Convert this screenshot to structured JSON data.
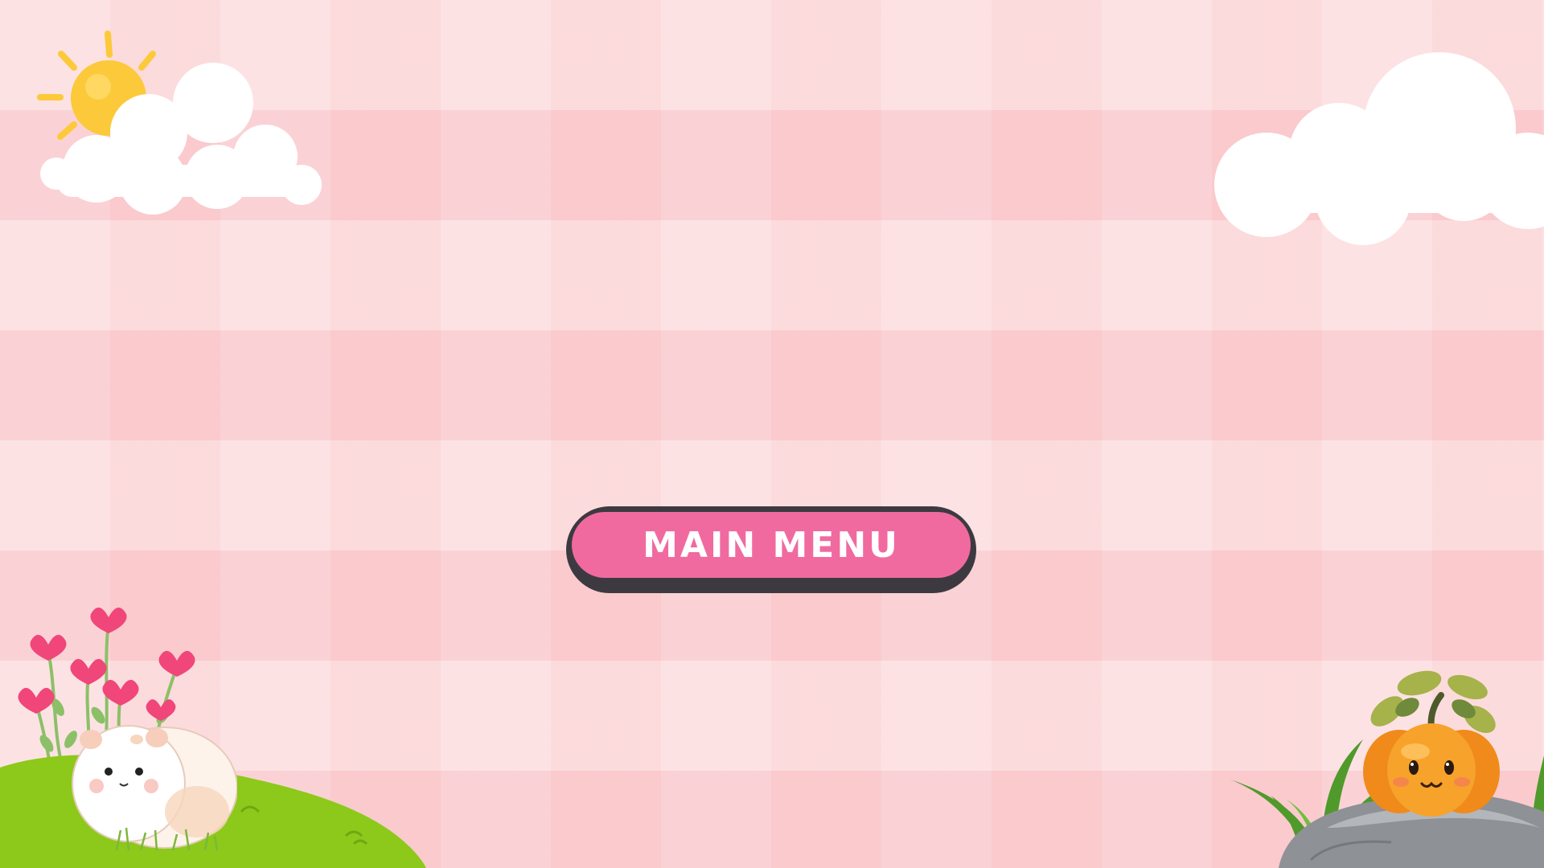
{
  "menu": {
    "main_menu_label": "MAIN MENU"
  },
  "decorations": {
    "icons": [
      "sun-icon",
      "cloud-icon",
      "flower-icon",
      "hamster-icon",
      "pumpkin-icon",
      "rock-icon",
      "grass-icon"
    ]
  },
  "colors": {
    "background": "#fcd6d8",
    "button_fill": "#f06aa0",
    "button_border": "#3c3a40",
    "button_text": "#ffffff",
    "grass": "#8cc91a",
    "pumpkin": "#f39a22",
    "sun": "#fcc93a"
  }
}
